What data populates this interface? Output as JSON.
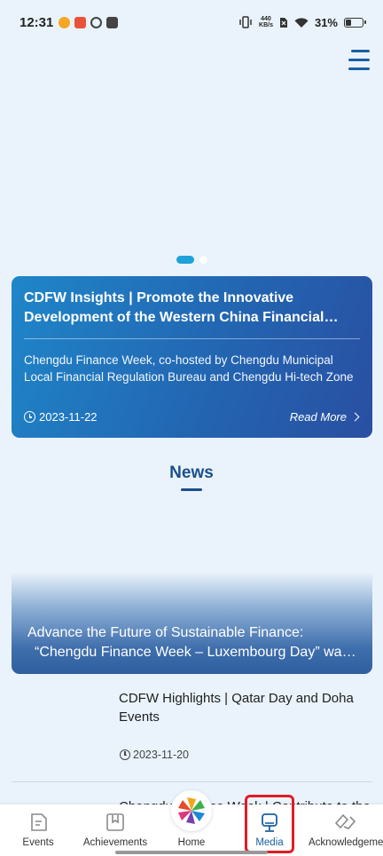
{
  "status_bar": {
    "time": "12:31",
    "net_speed_value": "440",
    "net_speed_unit": "KB/s",
    "battery_percent": "31%",
    "battery_level": 0.31
  },
  "insight_card": {
    "title": "CDFW Insights | Promote the Innovative Development of the Western China Financial Centre",
    "description": "Chengdu Finance Week, co-hosted by Chengdu Municipal Local Financial Regulation Bureau and Chengdu Hi-tech Zone",
    "date": "2023-11-22",
    "read_more": "Read More"
  },
  "news_section": {
    "heading": "News"
  },
  "featured_news": {
    "line1": "Advance the Future of Sustainable Finance:",
    "line2": "“Chengdu Finance Week – Luxembourg Day” was held"
  },
  "news_items": [
    {
      "title": "CDFW Highlights | Qatar Day and Doha Events",
      "date": "2023-11-20"
    },
    {
      "title": "Chengdu Finance Week | Contribute to the"
    }
  ],
  "bottom_nav": {
    "items": [
      {
        "label": "Events",
        "icon": "events-icon"
      },
      {
        "label": "Achievements",
        "icon": "achievements-icon"
      },
      {
        "label": "Home",
        "icon": "home-logo"
      },
      {
        "label": "Media",
        "icon": "media-icon"
      },
      {
        "label": "Acknowledgement",
        "icon": "acknowledgement-icon"
      }
    ],
    "active_index": 3
  },
  "colors": {
    "accent": "#1b4f8c",
    "card_gradient_start": "#1f86c9",
    "card_gradient_end": "#2a4fa2",
    "highlight": "#e01b24"
  }
}
